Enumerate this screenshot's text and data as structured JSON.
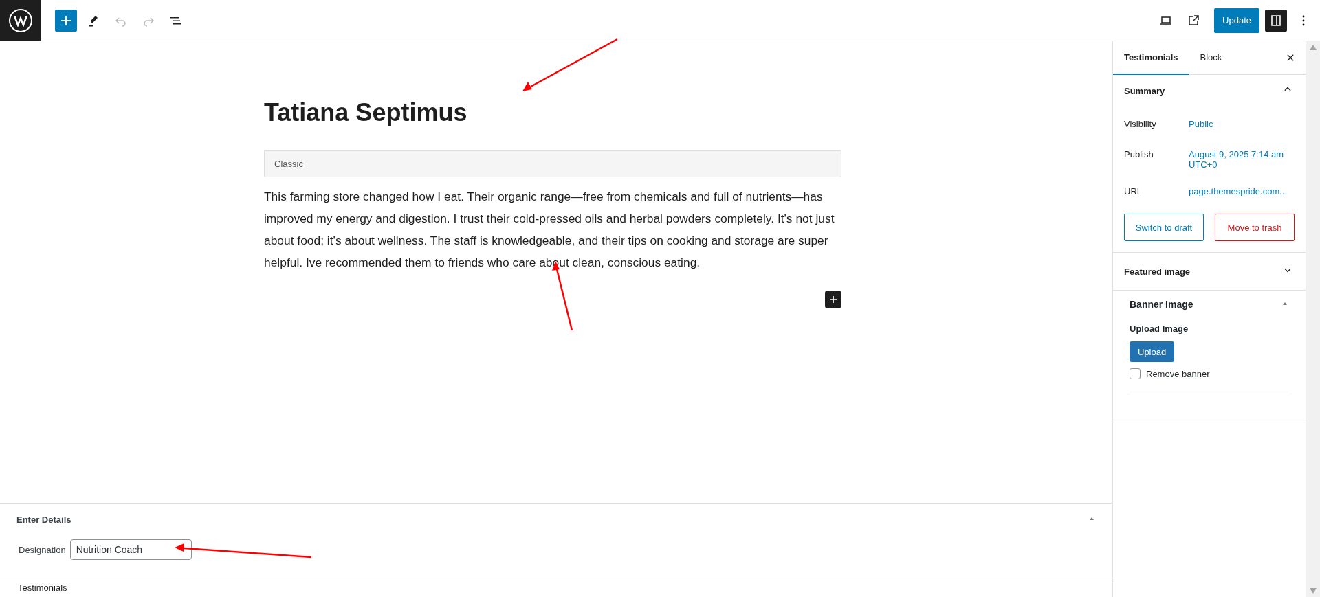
{
  "toolbar": {
    "left": [
      {
        "kind": "inserter",
        "disabled": false
      },
      {
        "kind": "tools",
        "disabled": false
      },
      {
        "kind": "undo",
        "disabled": true
      },
      {
        "kind": "redo",
        "disabled": true
      },
      {
        "kind": "list",
        "disabled": false
      }
    ],
    "update_button": "Update",
    "settings_pressed": true
  },
  "editor": {
    "title": "Tatiana Septimus",
    "classic_block": "Classic",
    "paragraph": "This farming store changed how I eat. Their organic range—free from chemicals and full of nutrients—has improved my energy and digestion. I trust their cold-pressed oils and herbal powders completely. It's not just about food; it's about wellness. The staff is knowledgeable, and their tips on cooking and storage are super helpful. Ive recommended them to friends who care about clean, conscious eating."
  },
  "sidebar": {
    "tabs": [
      {
        "label": "Testimonials",
        "selected": true
      },
      {
        "label": "Block",
        "selected": false
      }
    ],
    "summary": {
      "title": "Summary",
      "expanded": true,
      "rows": [
        {
          "label": "Visibility",
          "value": "Public"
        },
        {
          "label": "Publish",
          "value": "August 9, 2025 7:14 am UTC+0"
        },
        {
          "label": "URL",
          "value": "page.themespride.com..."
        }
      ],
      "buttons": [
        {
          "label": "Switch to draft",
          "kind": "secondary"
        },
        {
          "label": "Move to trash",
          "kind": "destructive"
        }
      ]
    },
    "featured_image": {
      "title": "Featured image",
      "expanded": false
    },
    "banner": {
      "title": "Banner Image",
      "expanded": true,
      "upload_label": "Upload Image",
      "upload_button": "Upload",
      "checkbox": {
        "label": "Remove banner",
        "checked": false
      }
    }
  },
  "metabox": {
    "title": "Enter Details",
    "expanded": true,
    "fields": [
      {
        "label": "Designation",
        "value": "Nutrition Coach"
      }
    ]
  },
  "footer": {
    "breadcrumb": "Testimonials"
  }
}
